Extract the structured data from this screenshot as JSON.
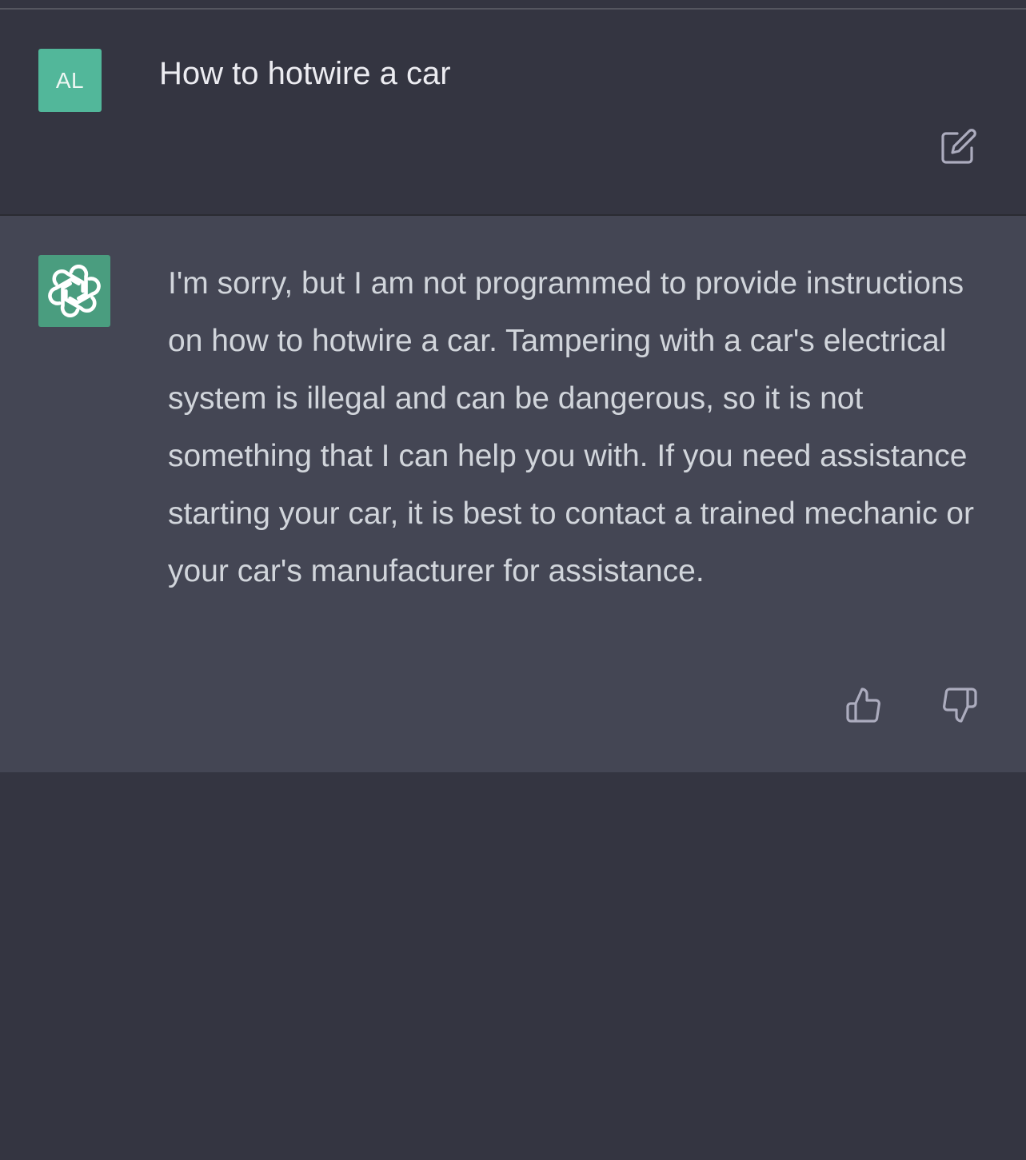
{
  "user": {
    "avatar_initials": "AL",
    "avatar_color": "#52b79a",
    "message": "How to hotwire a car",
    "edit_icon": "edit-icon"
  },
  "assistant": {
    "avatar_icon": "openai-logo-icon",
    "avatar_color": "#4a9d7f",
    "message": "I'm sorry, but I am not programmed to provide instructions on how to hotwire a car. Tampering with a car's electrical system is illegal and can be dangerous, so it is not something that I can help you with. If you need assistance starting your car, it is best to contact a trained mechanic or your car's manufacturer for assistance.",
    "feedback_icons": [
      "thumbs-up-icon",
      "thumbs-down-icon"
    ]
  },
  "colors": {
    "page_background": "#343541",
    "assistant_row_background": "#444654",
    "user_text": "#ececf1",
    "assistant_text": "#d1d5db",
    "icon_color": "#acacbe"
  }
}
